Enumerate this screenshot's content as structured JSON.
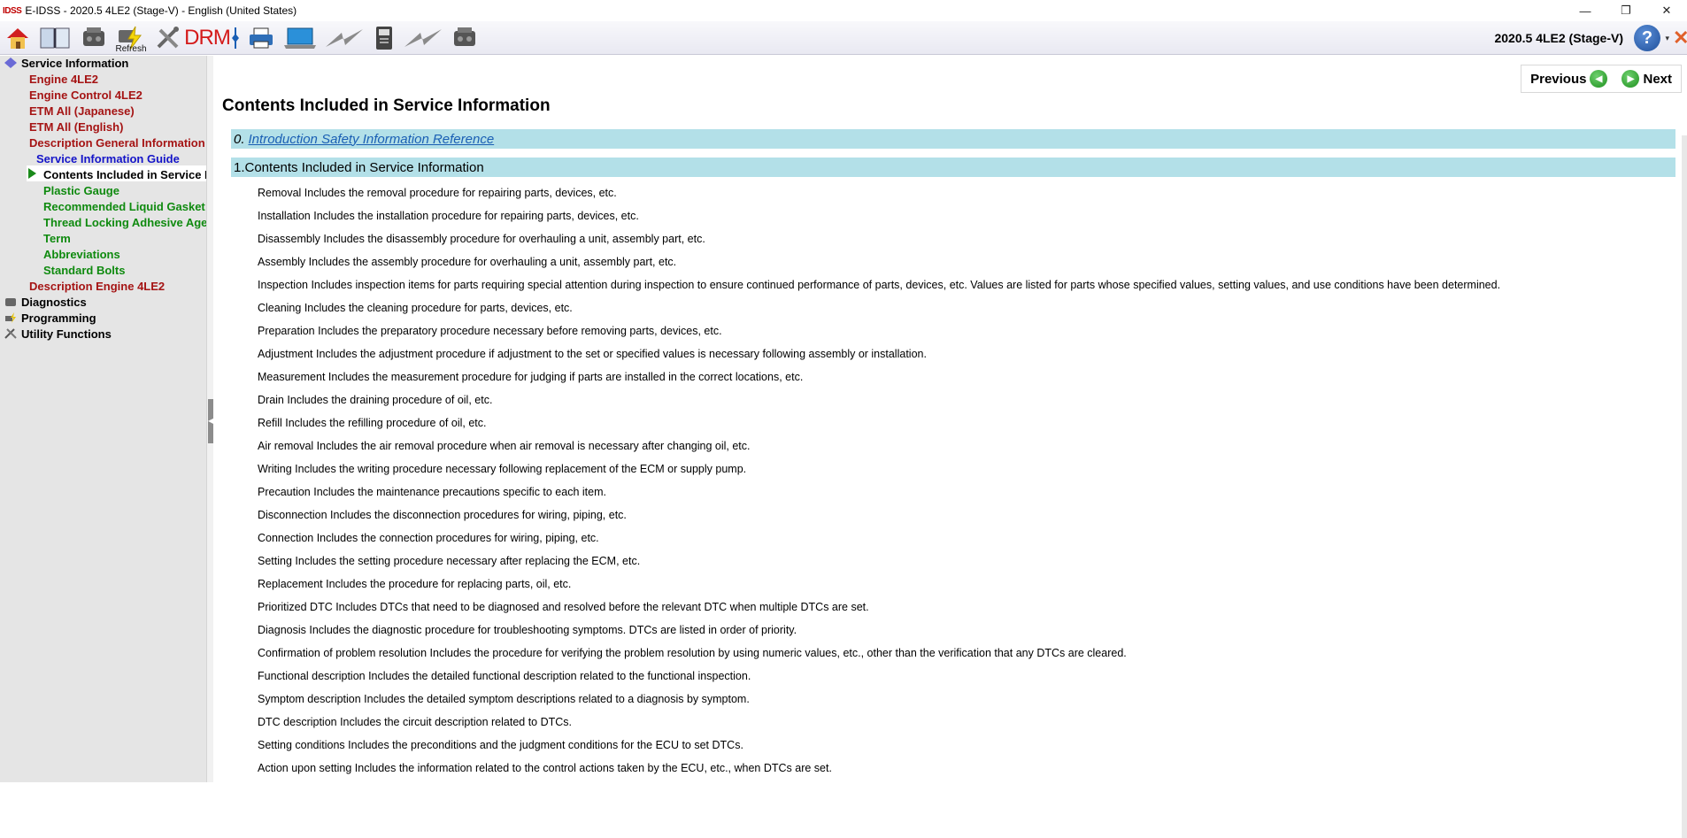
{
  "window": {
    "logo": "IDSS",
    "title": "E-IDSS - 2020.5 4LE2 (Stage-V)  - English (United States)",
    "minimize": "—",
    "restore": "❐",
    "close": "✕"
  },
  "toolbar": {
    "refresh_label": "Refresh",
    "drm_label": "DRM",
    "vehicle": "2020.5 4LE2 (Stage-V)",
    "help": "?",
    "help_arrow": "▾"
  },
  "sidebar": {
    "items": [
      {
        "label": "Service Information"
      },
      {
        "label": "Engine 4LE2"
      },
      {
        "label": "Engine Control 4LE2"
      },
      {
        "label": "ETM All (Japanese)"
      },
      {
        "label": "ETM All (English)"
      },
      {
        "label": "Description General Information"
      },
      {
        "label": "Service Information Guide"
      },
      {
        "label": "Contents Included in Service Information"
      },
      {
        "label": "Plastic Gauge"
      },
      {
        "label": "Recommended Liquid Gasket"
      },
      {
        "label": "Thread Locking Adhesive Agent"
      },
      {
        "label": "Term"
      },
      {
        "label": "Abbreviations"
      },
      {
        "label": "Standard Bolts"
      },
      {
        "label": "Description Engine 4LE2"
      },
      {
        "label": "Diagnostics"
      },
      {
        "label": "Programming"
      },
      {
        "label": "Utility Functions"
      }
    ]
  },
  "content": {
    "nav": {
      "previous": "Previous",
      "next": "Next"
    },
    "title": "Contents Included in Service Information",
    "sections": [
      {
        "prefix": "0.",
        "label": "Introduction Safety Information Reference"
      },
      {
        "prefix": "",
        "label": "1.Contents Included in Service Information"
      }
    ],
    "rows": [
      "Removal Includes the removal procedure for repairing parts, devices, etc.",
      "Installation Includes the installation procedure for repairing parts, devices, etc.",
      "Disassembly Includes the disassembly procedure for overhauling a unit, assembly part, etc.",
      "Assembly Includes the assembly procedure for overhauling a unit, assembly part, etc.",
      "Inspection Includes inspection items for parts requiring special attention during inspection to ensure continued performance of parts, devices, etc. Values are listed for parts whose specified values, setting values, and use conditions have been determined.",
      "Cleaning Includes the cleaning procedure for parts, devices, etc.",
      "Preparation Includes the preparatory procedure necessary before removing parts, devices, etc.",
      "Adjustment Includes the adjustment procedure if adjustment to the set or specified values is necessary following assembly or installation.",
      "Measurement Includes the measurement procedure for judging if parts are installed in the correct locations, etc.",
      "Drain Includes the draining procedure of oil, etc.",
      "Refill Includes the refilling procedure of oil, etc.",
      "Air removal Includes the air removal procedure when air removal is necessary after changing oil, etc.",
      "Writing Includes the writing procedure necessary following replacement of the ECM or supply pump.",
      "Precaution Includes the maintenance precautions specific to each item.",
      "Disconnection Includes the disconnection procedures for wiring, piping, etc.",
      "Connection Includes the connection procedures for wiring, piping, etc.",
      "Setting Includes the setting procedure necessary after replacing the ECM, etc.",
      "Replacement Includes the procedure for replacing parts, oil, etc.",
      "Prioritized DTC Includes DTCs that need to be diagnosed and resolved before the relevant DTC when multiple DTCs are set.",
      "Diagnosis Includes the diagnostic procedure for troubleshooting symptoms. DTCs are listed in order of priority.",
      "Confirmation of problem resolution Includes the procedure for verifying the problem resolution by using numeric values, etc., other than the verification that any DTCs are cleared.",
      "Functional description Includes the detailed functional description related to the functional inspection.",
      "Symptom description Includes the detailed symptom descriptions related to a diagnosis by symptom.",
      "DTC description Includes the circuit description related to DTCs.",
      "Setting conditions Includes the preconditions and the judgment conditions for the ECU to set DTCs.",
      "Action upon setting Includes the information related to the control actions taken by the ECU, etc., when DTCs are set."
    ]
  }
}
